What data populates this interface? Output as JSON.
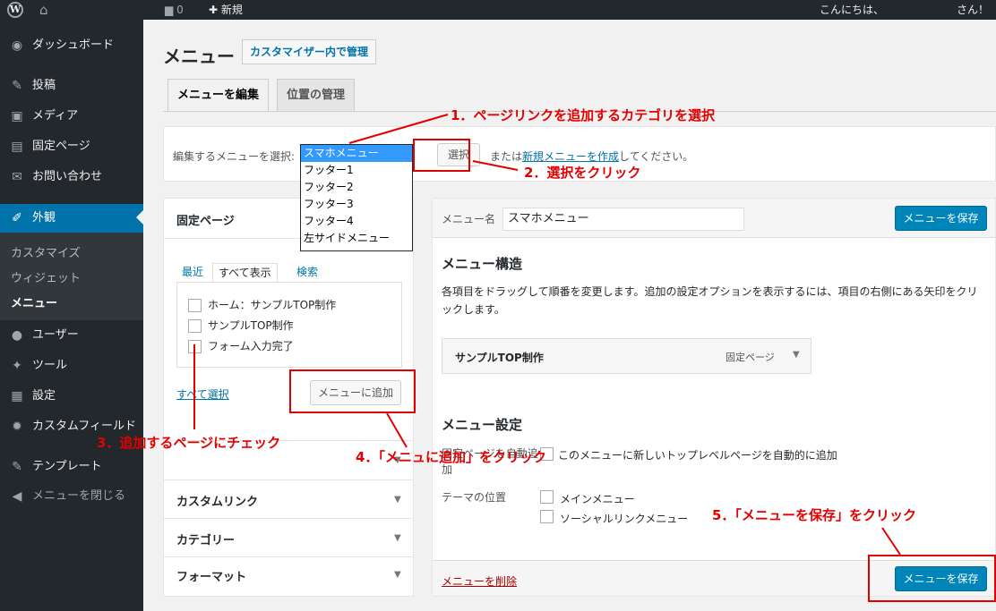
{
  "adminbar": {
    "wp_logo": "W",
    "comments_count": "0",
    "new_label": "新規",
    "greeting": "こんにちは、",
    "greeting_suffix": "さん！"
  },
  "sidebar": {
    "dashboard": "ダッシュボード",
    "posts": "投稿",
    "media": "メディア",
    "pages": "固定ページ",
    "contact": "お問い合わせ",
    "appearance": "外観",
    "sub_customize": "カスタマイズ",
    "sub_widgets": "ウィジェット",
    "sub_menus": "メニュー",
    "users": "ユーザー",
    "tools": "ツール",
    "settings": "設定",
    "custom_fields": "カスタムフィールド",
    "templates": "テンプレート",
    "collapse": "メニューを閉じる"
  },
  "header": {
    "title": "メニュー",
    "customizer_button": "カスタマイザー内で管理",
    "tab_edit": "メニューを編集",
    "tab_locations": "位置の管理"
  },
  "manage": {
    "label": "編集するメニューを選択:",
    "select_button": "選択",
    "or_prefix": "または",
    "create_link": "新規メニューを作成",
    "or_suffix": "してください。",
    "options": [
      "スマホメニュー",
      "フッター1",
      "フッター2",
      "フッター3",
      "フッター4",
      "左サイドメニュー"
    ]
  },
  "left": {
    "pages_title": "固定ページ",
    "tab_recent": "最近",
    "tab_all": "すべて表示",
    "tab_search": "検索",
    "items": [
      "ホーム：サンプルTOP制作",
      "サンプルTOP制作",
      "フォーム入力完了"
    ],
    "select_all": "すべて選択",
    "add_button": "メニューに追加",
    "custom_links": "カスタムリンク",
    "categories": "カテゴリー",
    "format": "フォーマット"
  },
  "right": {
    "name_label": "メニュー名",
    "name_value": "スマホメニュー",
    "save_label": "メニューを保存",
    "structure_title": "メニュー構造",
    "structure_desc": "各項目をドラッグして順番を変更します。追加の設定オプションを表示するには、項目の右側にある矢印をクリックします。",
    "item_title": "サンプルTOP制作",
    "item_type": "固定ページ",
    "settings_title": "メニュー設定",
    "auto_add_label": "固定ページを自動追加",
    "auto_add_text": "このメニューに新しいトップレベルページを自動的に追加",
    "theme_location_label": "テーマの位置",
    "location_main": "メインメニュー",
    "location_social": "ソーシャルリンクメニュー",
    "delete_link": "メニューを削除"
  },
  "annotations": {
    "step1": "1．ページリンクを追加するカテゴリを選択",
    "step2": "2．選択をクリック",
    "step3": "3．追加するページにチェック",
    "step4": "4．「メニュに追加」をクリック",
    "step5": "5．「メニューを保存」をクリック"
  },
  "colors": {
    "admin_dark": "#23282d",
    "accent_blue": "#0073aa",
    "primary_button": "#0085ba",
    "annotation_red": "#e30000"
  }
}
